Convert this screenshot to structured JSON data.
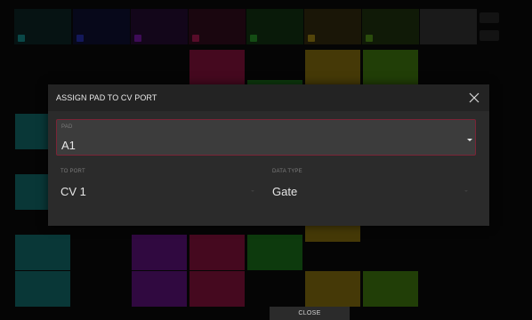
{
  "dialog": {
    "title": "ASSIGN PAD TO CV PORT",
    "pad": {
      "label": "PAD",
      "value": "A1"
    },
    "to_port": {
      "label": "TO PORT",
      "value": "CV 1"
    },
    "data_type": {
      "label": "DATA TYPE",
      "value": "Gate"
    }
  },
  "footer": {
    "close_label": "CLOSE"
  },
  "colors": {
    "accent_border": "#7a2436",
    "dialog_bg": "#2b2b2b",
    "header_bg": "#232323",
    "field_bg": "#3c3c3c"
  }
}
